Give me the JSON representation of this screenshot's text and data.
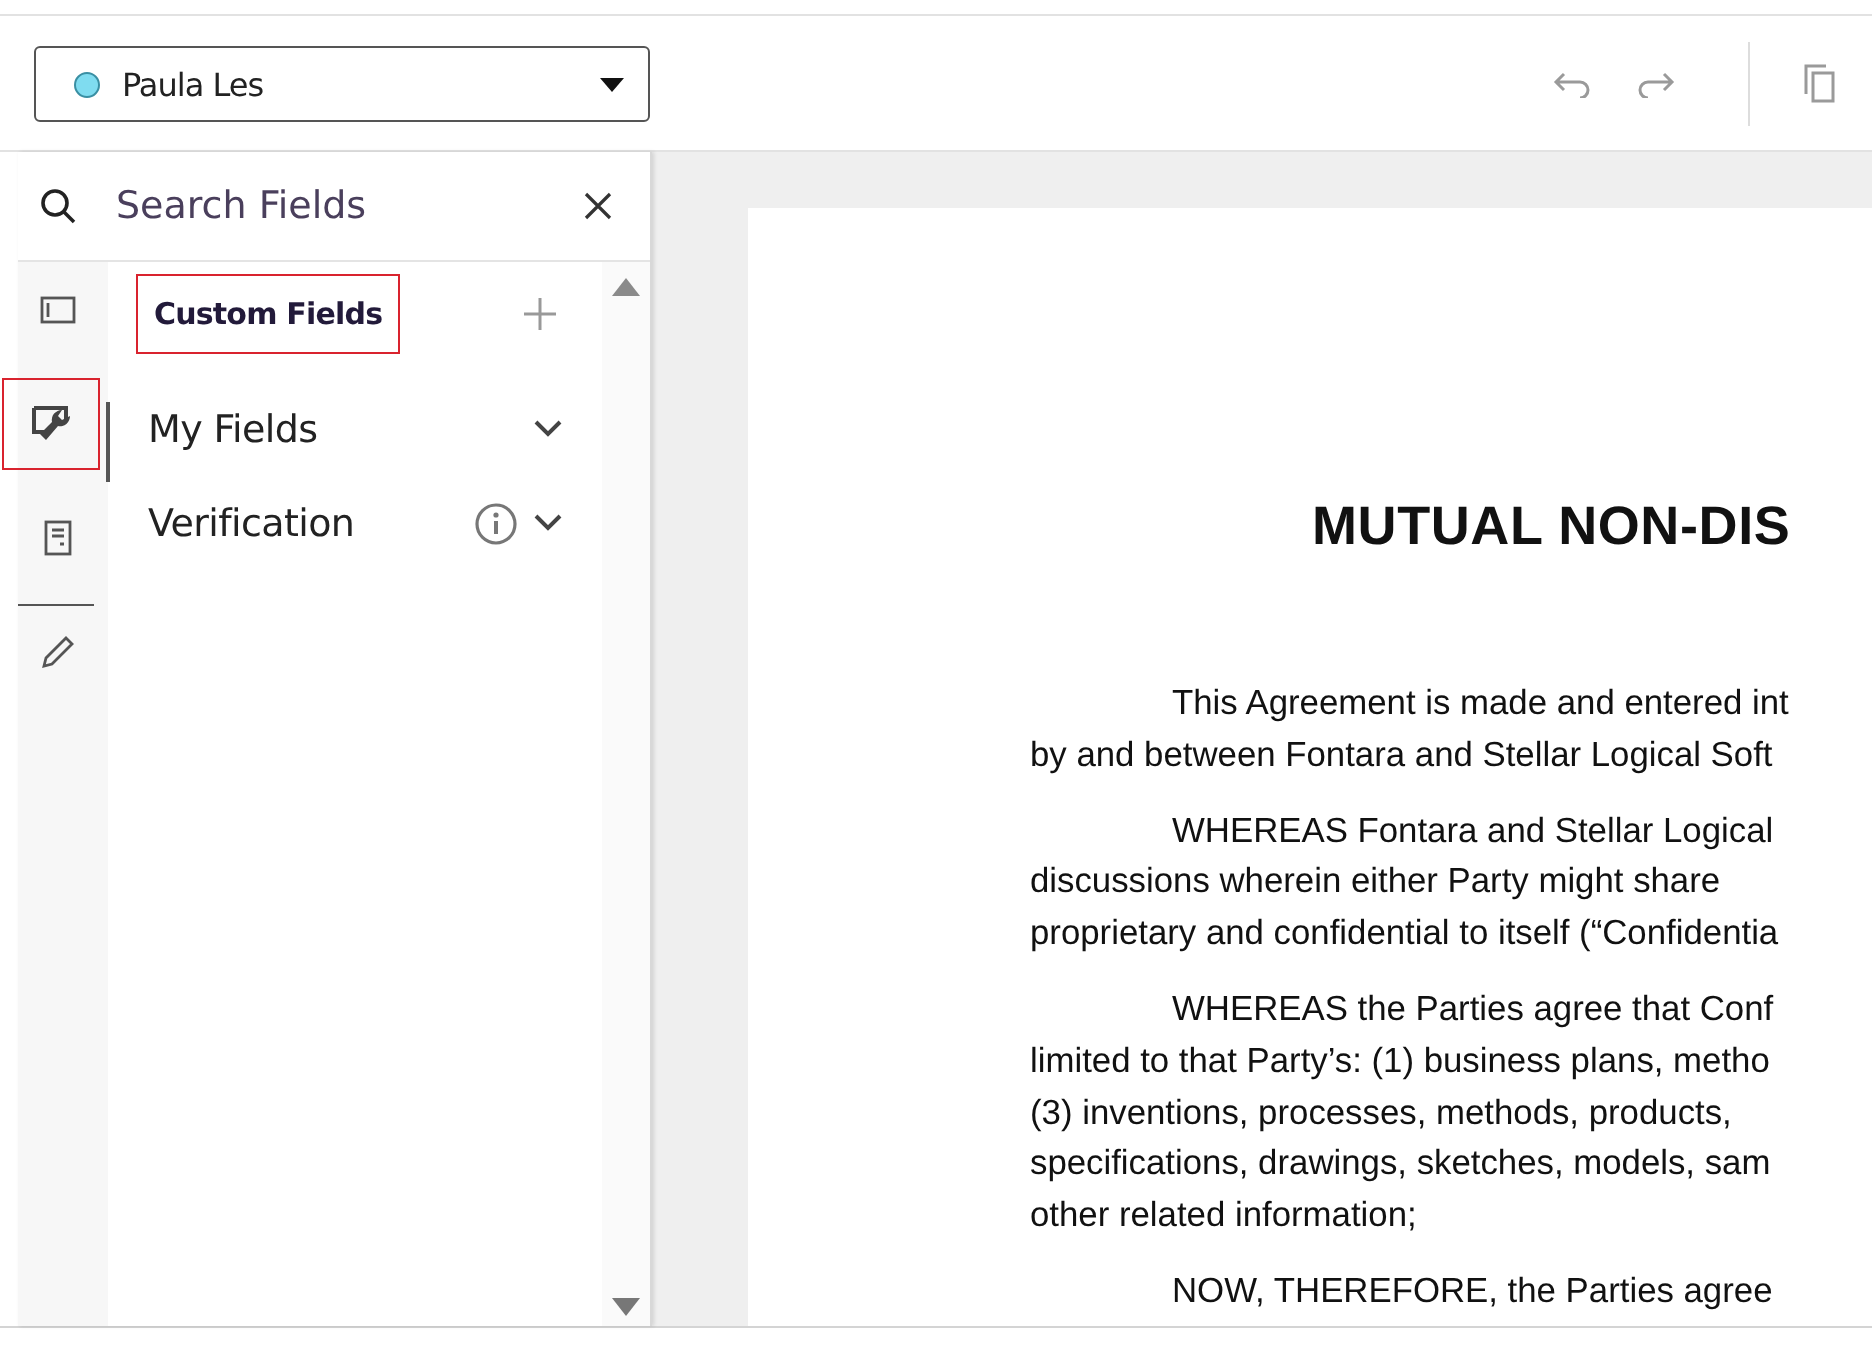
{
  "participant_select": {
    "value": "Paula Les",
    "color": "#7fdcf0"
  },
  "search": {
    "placeholder": "Search Fields"
  },
  "rail": [
    {
      "kind": "panel",
      "selected": false,
      "highlighted": false
    },
    {
      "kind": "wrench",
      "selected": true,
      "highlighted": true
    },
    {
      "kind": "document",
      "selected": false,
      "highlighted": false
    },
    {
      "kind": "pencil",
      "selected": false,
      "highlighted": false
    }
  ],
  "panel": {
    "title": "Custom Fields",
    "highlighted": true,
    "groups": [
      {
        "label": "My Fields",
        "info": false,
        "expanded": false
      },
      {
        "label": "Verification",
        "info": true,
        "expanded": false
      }
    ]
  },
  "document": {
    "title": "MUTUAL NON-DIS",
    "paragraphs": [
      [
        "This Agreement is made and entered int",
        "by and between Fontara and Stellar Logical Soft"
      ],
      [
        "WHEREAS Fontara and Stellar Logical",
        "discussions wherein either Party might share",
        "proprietary and confidential to itself (“Confidentia"
      ],
      [
        "WHEREAS the Parties agree that Conf",
        "limited to that Party’s: (1) business plans, metho",
        "(3) inventions, processes, methods, products,",
        "specifications, drawings, sketches, models, sam",
        "other related information;"
      ],
      [
        "NOW, THEREFORE, the Parties agree"
      ]
    ]
  }
}
